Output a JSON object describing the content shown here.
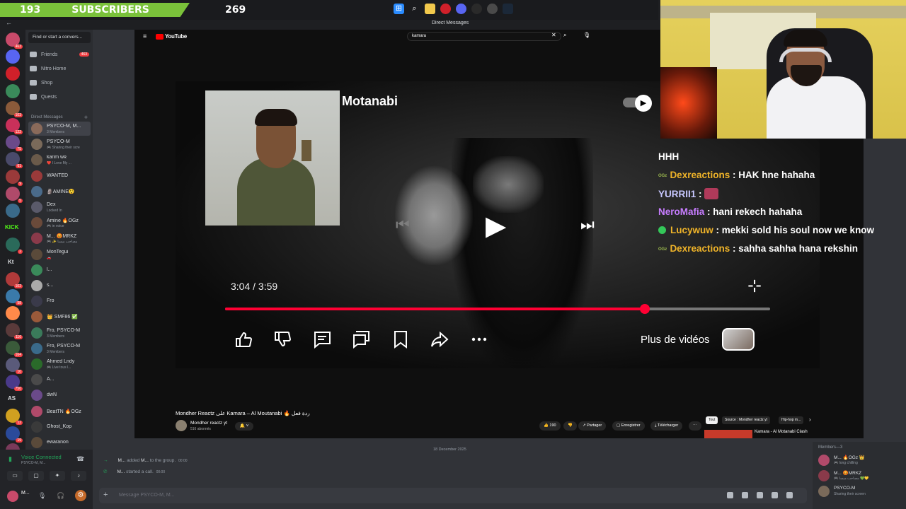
{
  "overlay": {
    "subs_current": "193",
    "subs_label": "SUBSCRIBERS",
    "subs_goal": "269",
    "accent_green": "#7ac13a"
  },
  "taskbar_icons": [
    "windows-icon",
    "search-icon",
    "folder-icon",
    "opera-icon",
    "discord-icon",
    "obs-icon",
    "chrome-icon",
    "steam-icon"
  ],
  "window": {
    "title": "Direct Messages"
  },
  "servers": [
    {
      "badge": "463"
    },
    {
      "badge": ""
    },
    {
      "badge": ""
    },
    {
      "badge": ""
    },
    {
      "badge": "103"
    },
    {
      "badge": "122"
    },
    {
      "badge": "75"
    },
    {
      "badge": "61"
    },
    {
      "badge": "9"
    },
    {
      "badge": "5"
    },
    {
      "badge": ""
    },
    {
      "badge": "KICK"
    },
    {
      "badge": "2"
    },
    {
      "badge": "Kt"
    },
    {
      "badge": "102"
    },
    {
      "badge": "58"
    },
    {
      "badge": ""
    },
    {
      "badge": "116"
    },
    {
      "badge": "164"
    },
    {
      "badge": "10"
    },
    {
      "badge": "750"
    },
    {
      "badge": "AS"
    },
    {
      "badge": "12"
    },
    {
      "badge": "19"
    },
    {
      "badge": "134"
    },
    {
      "badge": "NEW"
    }
  ],
  "sidebar": {
    "search_placeholder": "Find or start a convers...",
    "nav": [
      {
        "label": "Friends",
        "count": "463"
      },
      {
        "label": "Nitro Home",
        "count": ""
      },
      {
        "label": "Shop",
        "count": ""
      },
      {
        "label": "Quests",
        "count": ""
      }
    ],
    "dm_header": "Direct Messages",
    "dms": [
      {
        "name": "PSYCO-M, M...",
        "sub": "3 Members",
        "color": "#8a6a5a"
      },
      {
        "name": "PSYCO-M",
        "sub": "🎮 Sharing their scre",
        "color": "#7a6a5a"
      },
      {
        "name": "karim ᴡʀ",
        "sub": "❤️ I Love My ...",
        "color": "#6a5a4a"
      },
      {
        "name": "WANTED",
        "sub": "",
        "color": "#9a3a3a"
      },
      {
        "name": "🗿AMINE😲",
        "sub": "",
        "color": "#4a6a8a"
      },
      {
        "name": "Dex",
        "sub": "Locked In",
        "color": "#5a5a6a"
      },
      {
        "name": "Amine 🔥OGz",
        "sub": "🎮 in voice",
        "color": "#6a4a3a"
      },
      {
        "name": "M... 😡MRKZ",
        "sub": "🎮 ✨ مصاحب ميسا",
        "color": "#8a3a4a"
      },
      {
        "name": "MonTegui",
        "sub": "🚗",
        "color": "#5a4a3a"
      },
      {
        "name": "l...",
        "sub": "",
        "color": "#3a8a5a"
      },
      {
        "name": "s...",
        "sub": "",
        "color": "#aaaaaa"
      },
      {
        "name": "Fro",
        "sub": "",
        "color": "#3a3a4a"
      },
      {
        "name": "👑 SMF86 ✅",
        "sub": "",
        "color": "#9a5a3a"
      },
      {
        "name": "Fro, PSYCO-M",
        "sub": "3 Members",
        "color": "#3a7a5a"
      },
      {
        "name": "Fro, PSYCO-M",
        "sub": "3 Members",
        "color": "#3a6a8a"
      },
      {
        "name": "Ahmed Lndy",
        "sub": "🎮 Live tous l...",
        "color": "#2a6a2a"
      },
      {
        "name": "A...",
        "sub": "",
        "color": "#4a4a4a"
      },
      {
        "name": "dwN",
        "sub": "",
        "color": "#6a4a8a"
      },
      {
        "name": "BeatTN 🔥OGz",
        "sub": "",
        "color": "#b04a6a"
      },
      {
        "name": "Ghost_Kop",
        "sub": "",
        "color": "#3a3a3a"
      },
      {
        "name": "ewaranon",
        "sub": "",
        "color": "#5a4a3a"
      }
    ]
  },
  "voice": {
    "status": "Voice Connected",
    "channel": "PSYCO-M, M..."
  },
  "user": {
    "name": "M..."
  },
  "youtube": {
    "logo_text": "YouTube",
    "search_value": "kamara",
    "video_title_overlay": "Motanabi",
    "time": "3:04 / 3:59",
    "progress": 0.77,
    "more_videos": "Plus de vidéos",
    "title": "Mondher Reactz على Kamara – Al Moutanabi 🔥 ردة فعل",
    "channel": "Mondher reactz yt",
    "subscribers": "516 abonnés",
    "likes": "190",
    "share": "Partager",
    "save": "Enregistrer",
    "download": "Télécharger",
    "chips": [
      "Tout",
      "Source : Mondher reactz yt",
      "Hip-hop m..."
    ],
    "related_title": "Kamara - Al Motanabi Clash"
  },
  "chat": {
    "date": "18 December 2025",
    "messages": [
      {
        "actor": "M...",
        "text": "added",
        "target": "M...",
        "suffix": "to the group.",
        "time": "00:00"
      },
      {
        "actor": "M...",
        "text": "started a call.",
        "target": "",
        "suffix": "",
        "time": "00:00"
      }
    ],
    "input_placeholder": "Message PSYCO-M, M..."
  },
  "members": {
    "header": "Members—3",
    "list": [
      {
        "name": "M... 🔥OGz 👑",
        "sub": "🎮 long chilling",
        "color": "#b04a6a"
      },
      {
        "name": "M... 😡MRKZ",
        "sub": "🎮 مصاحب ميسا 💚💛",
        "color": "#8a3a4a"
      },
      {
        "name": "PSYCO-M",
        "sub": "Sharing their screen",
        "color": "#7a6a5a"
      }
    ]
  },
  "twitch_chat": [
    {
      "user": "",
      "msg": "HHH",
      "user_color": "#ffffff",
      "badge": ""
    },
    {
      "user": "Dexreactions",
      "msg": " : HAK hne hahaha",
      "user_color": "#f0b429",
      "badge": "OGz"
    },
    {
      "user": "YURRII1",
      "msg": " : ",
      "user_color": "#c8c8ff",
      "badge": "",
      "emote": true
    },
    {
      "user": "NeroMafia",
      "msg": " : hani rekech hahaha",
      "user_color": "#c77dff",
      "badge": ""
    },
    {
      "user": "Lucywuw",
      "msg": " : mekki sold his soul now we know",
      "user_color": "#f0b429",
      "badge": "check"
    },
    {
      "user": "Dexreactions",
      "msg": " : sahha sahha hana rekshin",
      "user_color": "#f0b429",
      "badge": "OGz"
    }
  ]
}
